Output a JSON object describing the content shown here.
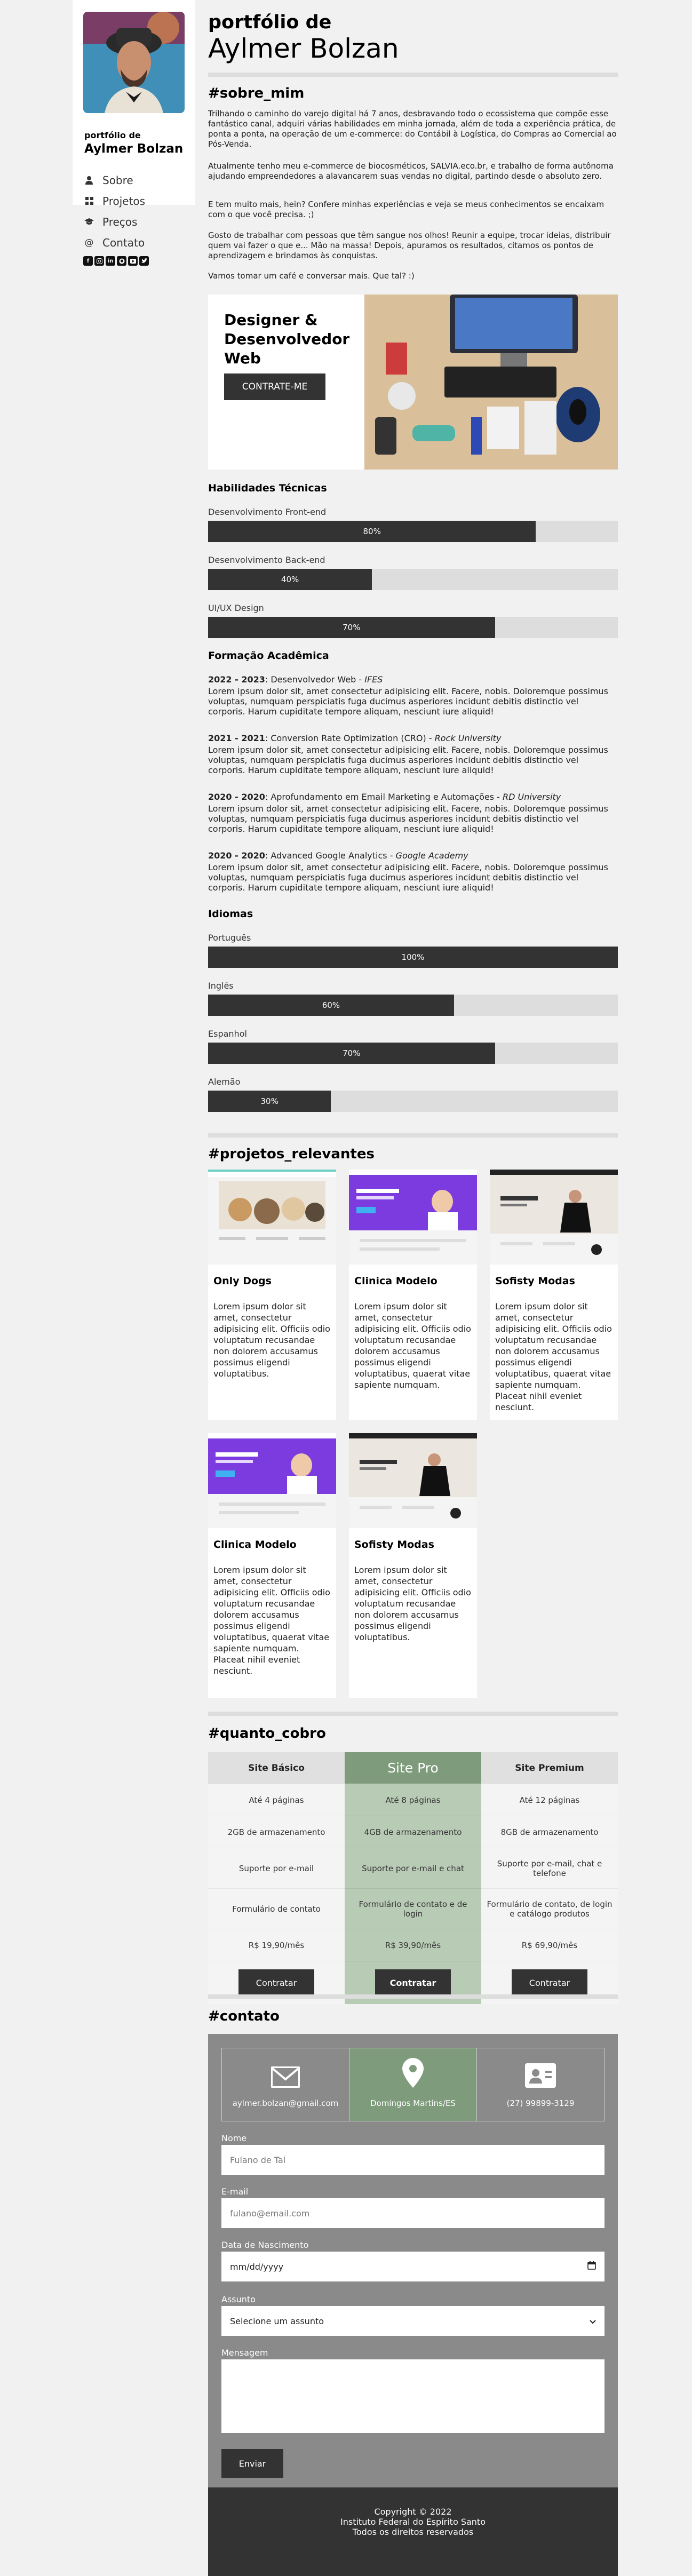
{
  "sidebar": {
    "subtitle": "portfólio de",
    "name": "Aylmer Bolzan",
    "menu": [
      {
        "label": "Sobre",
        "icon": "user-icon"
      },
      {
        "label": "Projetos",
        "icon": "grid-icon"
      },
      {
        "label": "Preços",
        "icon": "graduation-cap-icon"
      },
      {
        "label": "Contato",
        "icon": "at-sign-icon"
      }
    ],
    "socials": [
      "facebook-icon",
      "instagram-icon",
      "linkedin-icon",
      "github-icon",
      "youtube-icon",
      "twitter-icon"
    ]
  },
  "header": {
    "subtitle": "portfólio de",
    "name": "Aylmer Bolzan"
  },
  "about": {
    "title": "#sobre_mim",
    "paragraphs": [
      "Trilhando o caminho do varejo digital há 7 anos, desbravando todo o ecossistema que compõe esse fantástico canal, adquiri várias habilidades em minha jornada, além de toda a experiência prática, de ponta a ponta, na operação de um e-commerce: do Contábil à Logística, do Compras ao Comercial ao Pós-Venda.",
      "Atualmente tenho meu e-commerce de biocosméticos, SALVIA.eco.br, e trabalho de forma autônoma ajudando empreendedores a alavancarem suas vendas no digital, partindo desde o absoluto zero.",
      "E tem muito mais, hein? Confere minhas experiências e veja se meus conhecimentos se encaixam com o que você precisa. ;)",
      "Gosto de trabalhar com pessoas que têm sangue nos olhos! Reunir a equipe, trocar ideias, distribuir quem vai fazer o que e... Mão na massa! Depois, apuramos os resultados, citamos os pontos de aprendizagem e brindamos às conquistas.",
      "Vamos tomar um café e conversar mais. Que tal? :)"
    ]
  },
  "hero": {
    "title_lines": [
      "Designer &",
      "Desenvolvedor",
      "Web"
    ],
    "button": "CONTRATE-ME"
  },
  "skills": {
    "title": "Habilidades Técnicas",
    "items": [
      {
        "label": "Desenvolvimento Front-end",
        "value": "80%",
        "level": 0.8
      },
      {
        "label": "Desenvolvimento Back-end",
        "value": "40%",
        "level": 0.4
      },
      {
        "label": "UI/UX Design",
        "value": "70%",
        "level": 0.7
      }
    ]
  },
  "education": {
    "title": "Formação Acadêmica",
    "items": [
      {
        "years": "2022 - 2023",
        "course": ": Desenvolvedor Web - ",
        "school": "IFES",
        "text": "Lorem ipsum dolor sit, amet consectetur adipisicing elit. Facere, nobis. Doloremque possimus voluptas, numquam perspiciatis fuga ducimus asperiores incidunt debitis distinctio vel corporis. Harum cupiditate tempore aliquam, nesciunt iure aliquid!"
      },
      {
        "years": "2021 - 2021",
        "course": ": Conversion Rate Optimization (CRO) - ",
        "school": "Rock University",
        "text": "Lorem ipsum dolor sit, amet consectetur adipisicing elit. Facere, nobis. Doloremque possimus voluptas, numquam perspiciatis fuga ducimus asperiores incidunt debitis distinctio vel corporis. Harum cupiditate tempore aliquam, nesciunt iure aliquid!"
      },
      {
        "years": "2020 - 2020",
        "course": ": Aprofundamento em Email Marketing e Automações - ",
        "school": "RD University",
        "text": "Lorem ipsum dolor sit, amet consectetur adipisicing elit. Facere, nobis. Doloremque possimus voluptas, numquam perspiciatis fuga ducimus asperiores incidunt debitis distinctio vel corporis. Harum cupiditate tempore aliquam, nesciunt iure aliquid!"
      },
      {
        "years": "2020 - 2020",
        "course": ": Advanced Google Analytics - ",
        "school": "Google Academy",
        "text": "Lorem ipsum dolor sit, amet consectetur adipisicing elit. Facere, nobis. Doloremque possimus voluptas, numquam perspiciatis fuga ducimus asperiores incidunt debitis distinctio vel corporis. Harum cupiditate tempore aliquam, nesciunt iure aliquid!"
      }
    ]
  },
  "languages": {
    "title": "Idiomas",
    "items": [
      {
        "label": "Português",
        "value": "100%",
        "level": 1.0
      },
      {
        "label": "Inglês",
        "value": "60%",
        "level": 0.6
      },
      {
        "label": "Espanhol",
        "value": "70%",
        "level": 0.7
      },
      {
        "label": "Alemão",
        "value": "30%",
        "level": 0.3
      }
    ]
  },
  "projects": {
    "title": "#projetos_relevantes",
    "items": [
      {
        "title": "Only Dogs",
        "text": "Lorem ipsum dolor sit amet, consectetur adipisicing elit. Officiis odio voluptatum recusandae non dolorem accusamus possimus eligendi voluptatibus."
      },
      {
        "title": "Clinica Modelo",
        "text": "Lorem ipsum dolor sit amet, consectetur adipisicing elit. Officiis odio voluptatum recusandae dolorem accusamus possimus eligendi voluptatibus, quaerat vitae sapiente numquam."
      },
      {
        "title": "Sofisty Modas",
        "text": "Lorem ipsum dolor sit amet, consectetur adipisicing elit. Officiis odio voluptatum recusandae non dolorem accusamus possimus eligendi voluptatibus, quaerat vitae sapiente numquam. Placeat nihil eveniet nesciunt."
      },
      {
        "title": "Clinica Modelo",
        "text": "Lorem ipsum dolor sit amet, consectetur adipisicing elit. Officiis odio voluptatum recusandae dolorem accusamus possimus eligendi voluptatibus, quaerat vitae sapiente numquam. Placeat nihil eveniet nesciunt."
      },
      {
        "title": "Sofisty Modas",
        "text": "Lorem ipsum dolor sit amet, consectetur adipisicing elit. Officiis odio voluptatum recusandae non dolorem accusamus possimus eligendi voluptatibus."
      }
    ]
  },
  "pricing": {
    "title": "#quanto_cobro",
    "highlight_color": "#b8cbb5",
    "highlight_head_color": "#7e9c7b",
    "plans": [
      {
        "name": "Site Básico",
        "features": [
          "Até 4 páginas",
          "2GB de armazenamento",
          "Suporte por e-mail",
          "Formulário de contato"
        ],
        "price": "R$ 19,90/mês",
        "button": "Contratar"
      },
      {
        "name": "Site Pro",
        "features": [
          "Até 8 páginas",
          "4GB de armazenamento",
          "Suporte por e-mail e chat",
          "Formulário de contato e de login"
        ],
        "price": "R$ 39,90/mês",
        "button": "Contratar"
      },
      {
        "name": "Site Premium",
        "features": [
          "Até 12 páginas",
          "8GB de armazenamento",
          "Suporte por e-mail, chat e telefone",
          "Formulário de contato, de login e catálogo produtos"
        ],
        "price": "R$ 69,90/mês",
        "button": "Contratar"
      }
    ]
  },
  "contact": {
    "title": "#contato",
    "cards": [
      {
        "icon": "envelope-icon",
        "text": "aylmer.bolzan@gmail.com"
      },
      {
        "icon": "map-pin-icon",
        "text": "Domingos Martins/ES"
      },
      {
        "icon": "contact-card-icon",
        "text": "(27) 99899-3129"
      }
    ],
    "form": {
      "name_label": "Nome",
      "name_placeholder": "Fulano de Tal",
      "email_label": "E-mail",
      "email_placeholder": "fulano@email.com",
      "birth_label": "Data de Nascimento",
      "birth_placeholder": "mm/dd/yyyy",
      "subject_label": "Assunto",
      "subject_value": "Selecione um assunto",
      "message_label": "Mensagem",
      "send": "Enviar"
    },
    "footer": [
      "Copyright © 2022",
      "Instituto Federal do Espírito Santo",
      "Todos os direitos reservados"
    ]
  }
}
